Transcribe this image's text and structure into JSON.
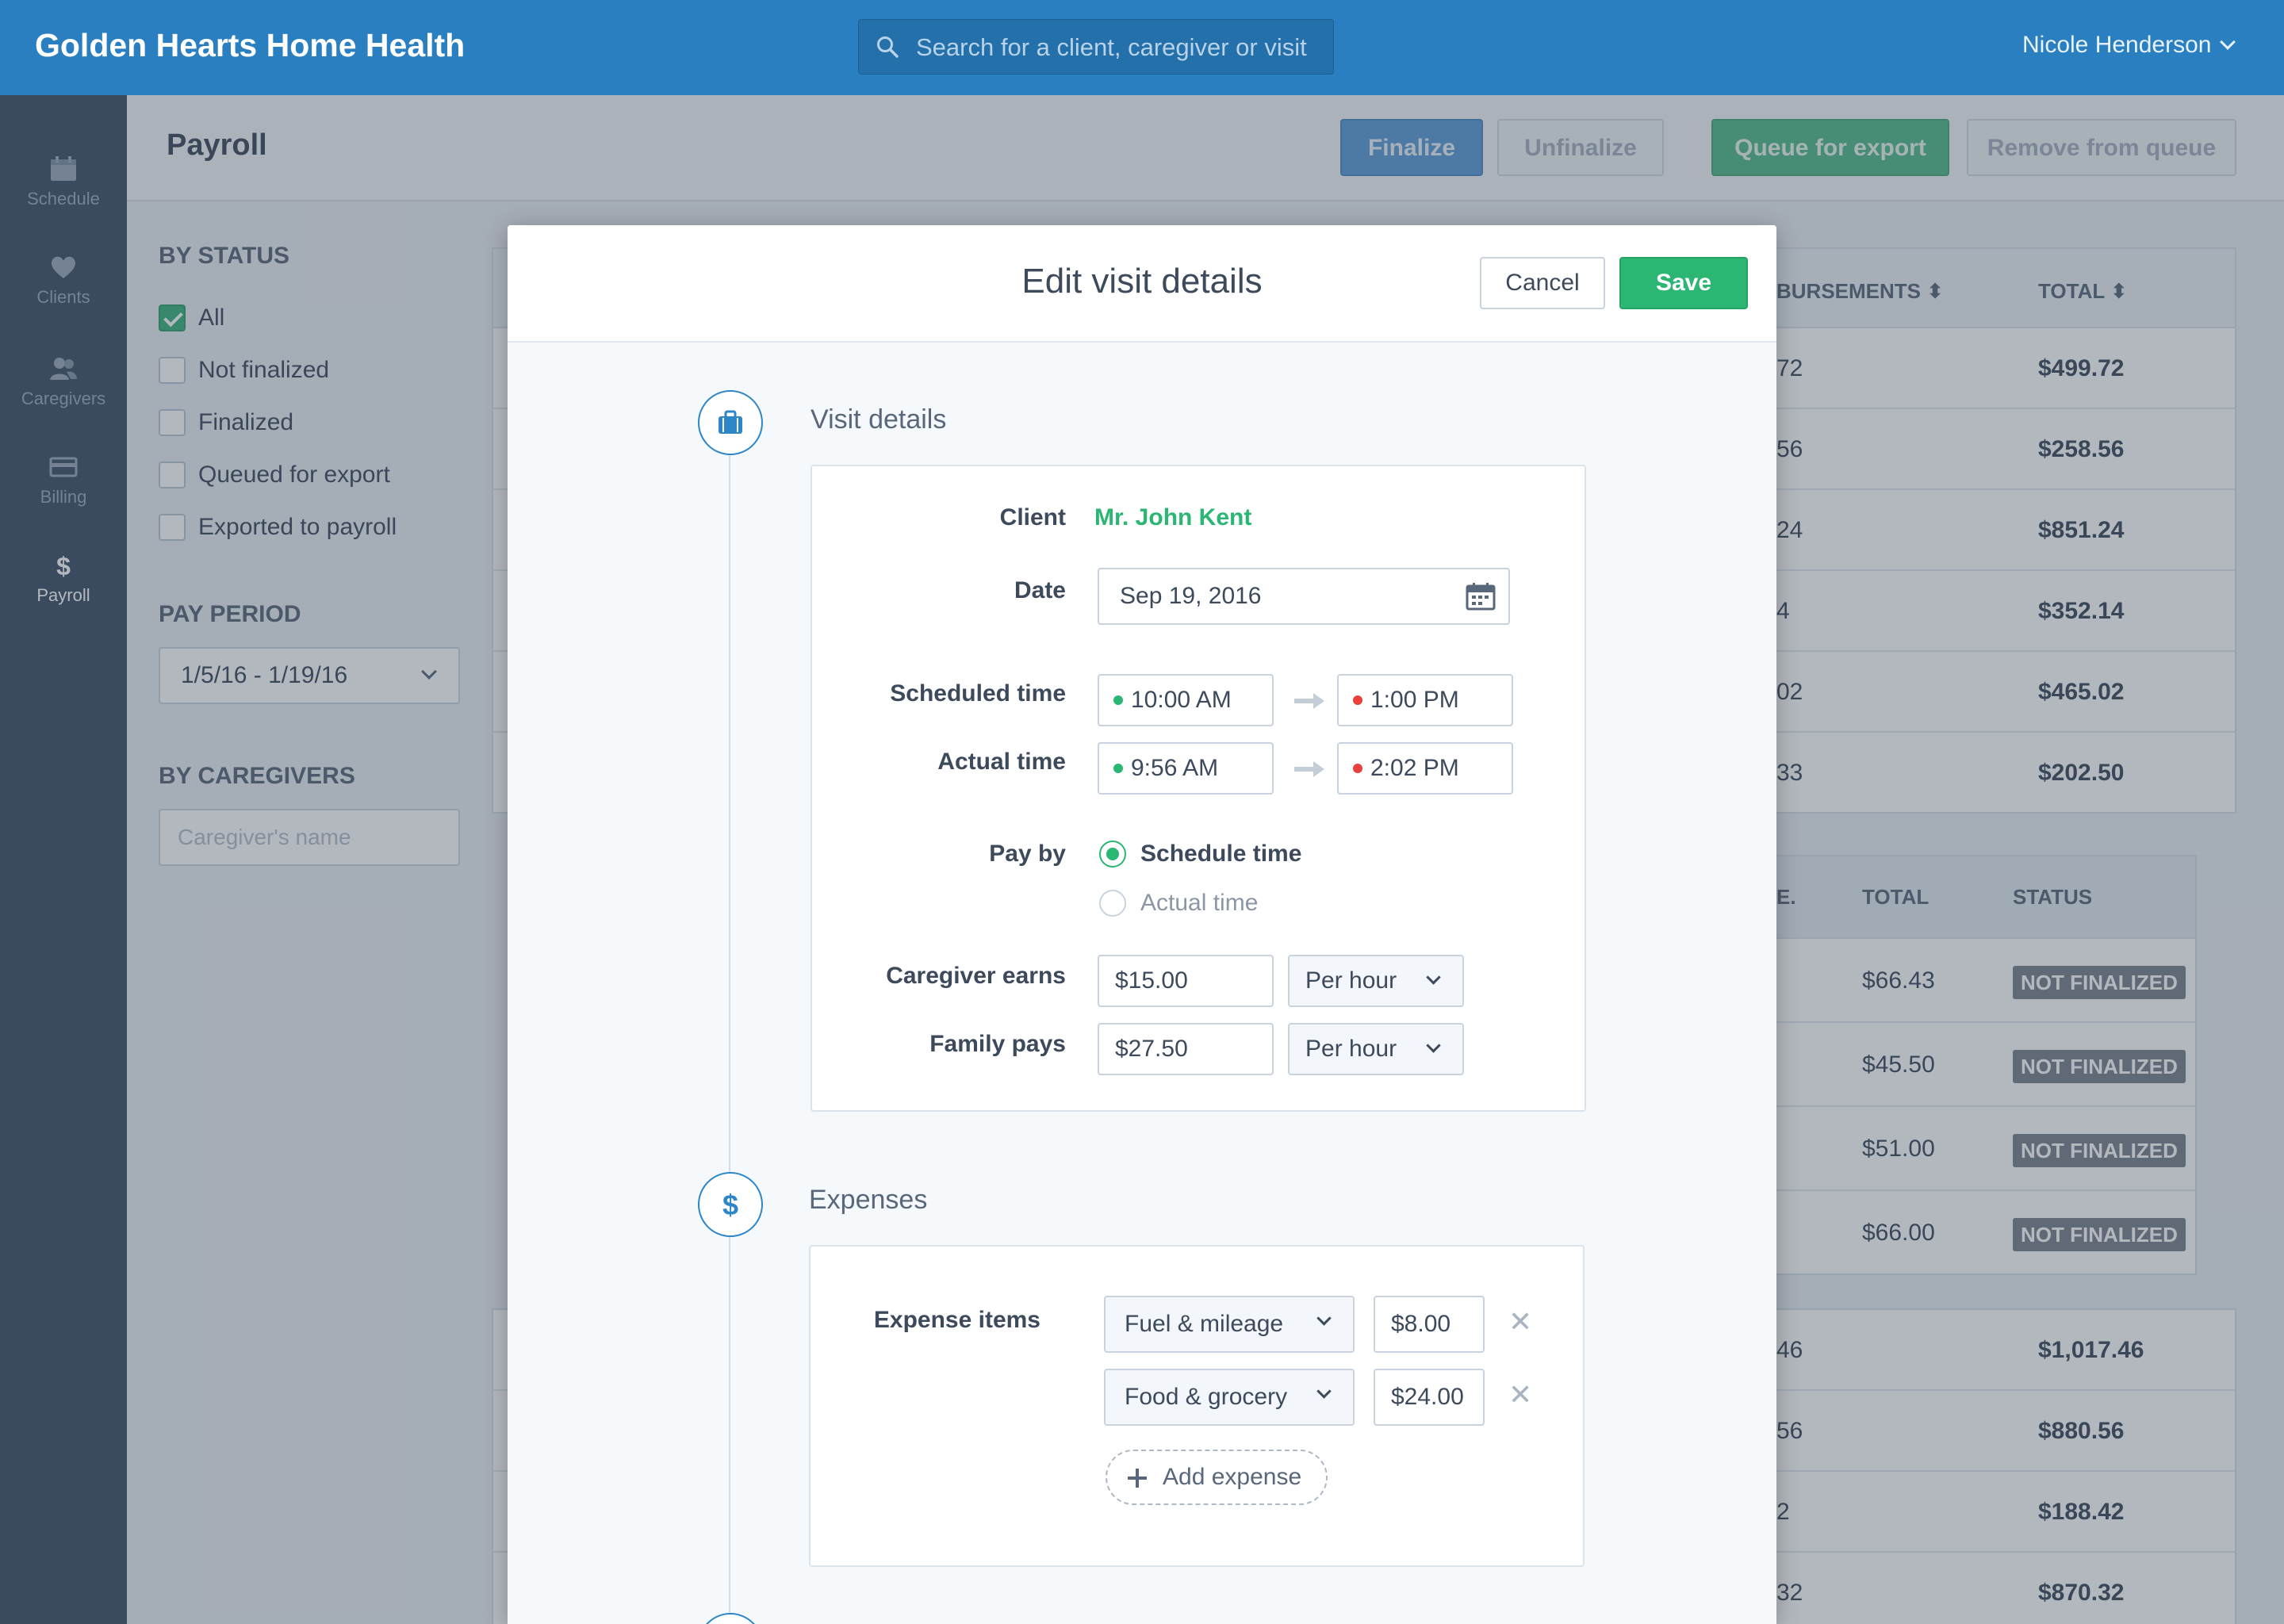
{
  "app": {
    "title": "Golden Hearts Home Health"
  },
  "search": {
    "placeholder": "Search for a client, caregiver or visit"
  },
  "user": {
    "name": "Nicole Henderson"
  },
  "nav": [
    {
      "label": "Schedule",
      "icon": "calendar-icon"
    },
    {
      "label": "Clients",
      "icon": "heart-icon"
    },
    {
      "label": "Caregivers",
      "icon": "people-icon"
    },
    {
      "label": "Billing",
      "icon": "card-icon"
    },
    {
      "label": "Payroll",
      "icon": "dollar-icon",
      "active": true
    }
  ],
  "page": {
    "title": "Payroll",
    "buttons": {
      "finalize": "Finalize",
      "unfinalize": "Unfinalize",
      "queue": "Queue for export",
      "remove": "Remove from queue"
    }
  },
  "filters": {
    "by_status": "BY STATUS",
    "statuses": [
      {
        "label": "All",
        "checked": true
      },
      {
        "label": "Not finalized",
        "checked": false
      },
      {
        "label": "Finalized",
        "checked": false
      },
      {
        "label": "Queued for export",
        "checked": false
      },
      {
        "label": "Exported to payroll",
        "checked": false
      }
    ],
    "pay_period_label": "PAY PERIOD",
    "pay_period_value": "1/5/16 - 1/19/16",
    "by_caregivers": "BY CAREGIVERS",
    "caregiver_placeholder": "Caregiver's name"
  },
  "table1": {
    "headers": {
      "reimb": "BURSEMENTS",
      "total": "TOTAL"
    },
    "rows": [
      {
        "reimb": "72",
        "total": "$499.72"
      },
      {
        "reimb": "56",
        "total": "$258.56"
      },
      {
        "reimb": "24",
        "total": "$851.24"
      },
      {
        "reimb": "4",
        "total": "$352.14"
      },
      {
        "reimb": "02",
        "total": "$465.02"
      },
      {
        "reimb": "33",
        "total": "$202.50"
      }
    ]
  },
  "table2": {
    "headers": {
      "e": "E.",
      "total": "TOTAL",
      "status": "STATUS"
    },
    "rows": [
      {
        "total": "$66.43",
        "status": "NOT FINALIZED"
      },
      {
        "total": "$45.50",
        "status": "NOT FINALIZED"
      },
      {
        "total": "$51.00",
        "status": "NOT FINALIZED"
      },
      {
        "total": "$66.00",
        "status": "NOT FINALIZED"
      }
    ]
  },
  "table3": {
    "rows": [
      {
        "reimb": "46",
        "total": "$1,017.46"
      },
      {
        "reimb": "56",
        "total": "$880.56"
      },
      {
        "reimb": "2",
        "total": "$188.42"
      },
      {
        "reimb": "32",
        "total": "$870.32"
      }
    ]
  },
  "modal": {
    "title": "Edit visit details",
    "cancel": "Cancel",
    "save": "Save",
    "visit_details": {
      "title": "Visit details",
      "client_label": "Client",
      "client_value": "Mr. John Kent",
      "date_label": "Date",
      "date_value": "Sep 19, 2016",
      "scheduled_label": "Scheduled time",
      "scheduled_start": "10:00 AM",
      "scheduled_end": "1:00 PM",
      "actual_label": "Actual time",
      "actual_start": "9:56 AM",
      "actual_end": "2:02 PM",
      "payby_label": "Pay by",
      "payby_options": [
        "Schedule time",
        "Actual time"
      ],
      "payby_selected": "Schedule time",
      "earns_label": "Caregiver earns",
      "earns_value": "$15.00",
      "earns_unit": "Per hour",
      "pays_label": "Family pays",
      "pays_value": "$27.50",
      "pays_unit": "Per hour"
    },
    "expenses": {
      "title": "Expenses",
      "items_label": "Expense items",
      "items": [
        {
          "type": "Fuel & mileage",
          "amount": "$8.00"
        },
        {
          "type": "Food & grocery",
          "amount": "$24.00"
        }
      ],
      "add_label": "Add expense"
    }
  },
  "colors": {
    "brand": "#2a7fc1",
    "accent_green": "#2bb673",
    "nav_bg": "#3d4f66",
    "danger": "#e8413c"
  }
}
